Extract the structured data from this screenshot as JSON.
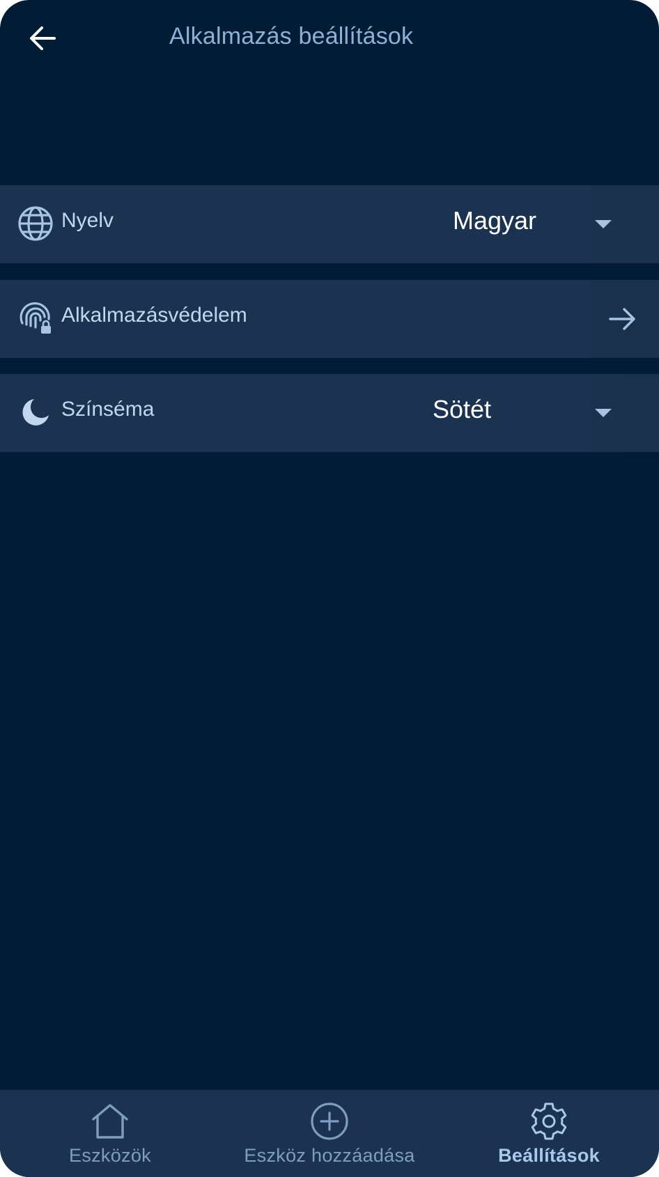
{
  "header": {
    "title": "Alkalmazás beállítások",
    "back_icon": "arrow-left-icon"
  },
  "settings": {
    "language": {
      "label": "Nyelv",
      "value": "Magyar",
      "icon": "globe-icon"
    },
    "app_protection": {
      "label": "Alkalmazásvédelem",
      "icon": "fingerprint-lock-icon"
    },
    "theme": {
      "label": "Színséma",
      "value": "Sötét",
      "icon": "moon-icon"
    }
  },
  "bottom_nav": {
    "items": [
      {
        "label": "Eszközök",
        "icon": "home-icon",
        "active": false
      },
      {
        "label": "Eszköz hozzáadása",
        "icon": "add-circle-icon",
        "active": false
      },
      {
        "label": "Beállítások",
        "icon": "gear-icon",
        "active": true
      }
    ]
  },
  "colors": {
    "background": "#021c35",
    "row_background": "#1b3350",
    "accent_text": "#8fb0d6",
    "active_nav": "#a8c8ec"
  }
}
